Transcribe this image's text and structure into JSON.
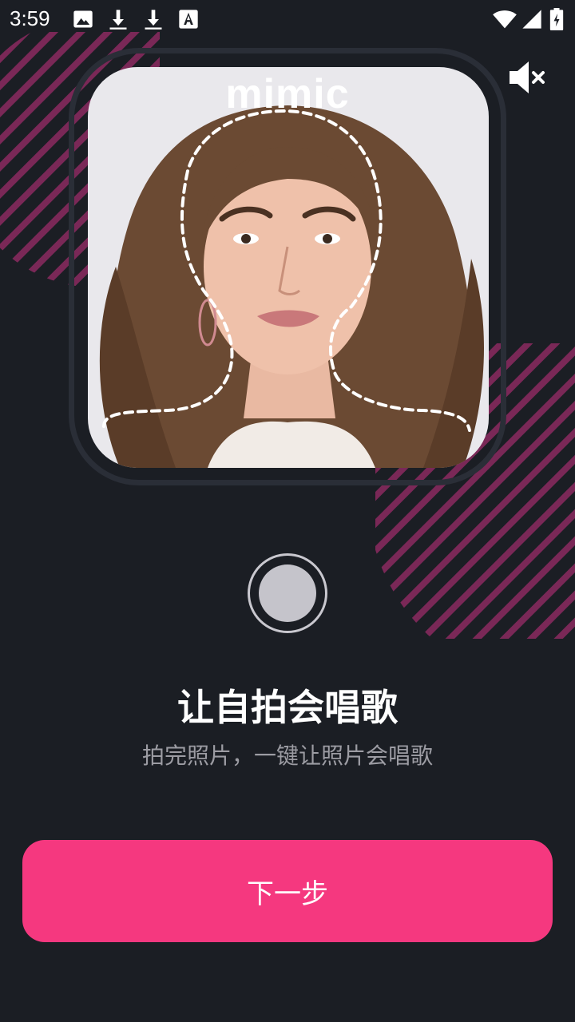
{
  "status_bar": {
    "time": "3:59",
    "icons": [
      "image-icon",
      "download-icon",
      "download-icon",
      "font-icon",
      "wifi-icon",
      "signal-icon",
      "battery-icon"
    ]
  },
  "brand": {
    "logo": "mimic"
  },
  "photo": {
    "description_icon": "face-outline-guide"
  },
  "main": {
    "title": "让自拍会唱歌",
    "subtitle": "拍完照片，一键让照片会唱歌"
  },
  "actions": {
    "next_label": "下一步"
  },
  "colors": {
    "accent": "#f5387f",
    "background": "#1b1e24",
    "stripe": "#7a2857"
  }
}
